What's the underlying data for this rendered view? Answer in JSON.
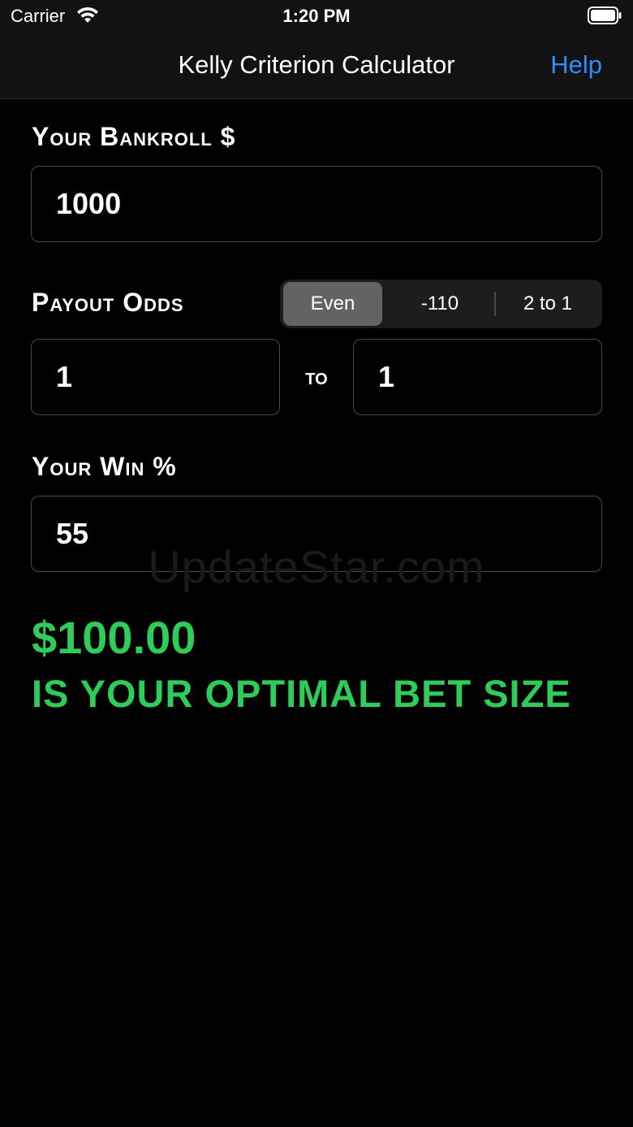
{
  "status_bar": {
    "carrier": "Carrier",
    "time": "1:20 PM",
    "wifi_icon": "wifi-icon",
    "battery_icon": "battery-icon"
  },
  "nav": {
    "title": "Kelly Criterion Calculator",
    "help_label": "Help"
  },
  "bankroll": {
    "label": "Your Bankroll $",
    "value": "1000"
  },
  "payout": {
    "label": "Payout Odds",
    "segments": [
      "Even",
      "-110",
      "2 to 1"
    ],
    "selected_segment": "Even",
    "odds_left": "1",
    "to_label": "to",
    "odds_right": "1"
  },
  "win": {
    "label": "Your Win %",
    "value": "55"
  },
  "watermark": "UpdateStar.com",
  "result": {
    "amount": "$100.00",
    "caption": "IS YOUR OPTIMAL BET SIZE"
  },
  "colors": {
    "background": "#000000",
    "bar_background": "#121212",
    "accent_blue": "#2f8cff",
    "result_green": "#2ecc58",
    "segment_selected": "#636366"
  }
}
